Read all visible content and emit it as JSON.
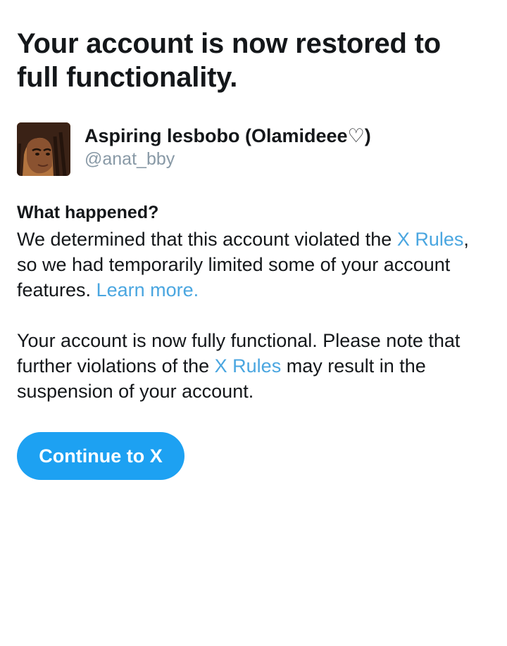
{
  "header": {
    "title": "Your account is now restored to full functionality."
  },
  "account": {
    "display_name": "Aspiring lesbobo (Olamideee♡)",
    "handle": "@anat_bby",
    "avatar_icon": "profile-avatar-illustration"
  },
  "what_happened": {
    "heading": "What happened?",
    "p1_text1": "We determined that this account violated the ",
    "p1_link1": "X Rules",
    "p1_text2": ", so we had temporarily limited some of your account features. ",
    "p1_link2": "Learn more.",
    "p2_text1": "Your account is now fully functional. Please note that further violations of the ",
    "p2_link1": "X Rules",
    "p2_text2": " may result in the suspension of your account."
  },
  "actions": {
    "continue_label": "Continue to X"
  },
  "colors": {
    "link": "#4aa6e0",
    "button": "#1da1f2",
    "handle": "#8899a6",
    "text": "#14171a"
  }
}
